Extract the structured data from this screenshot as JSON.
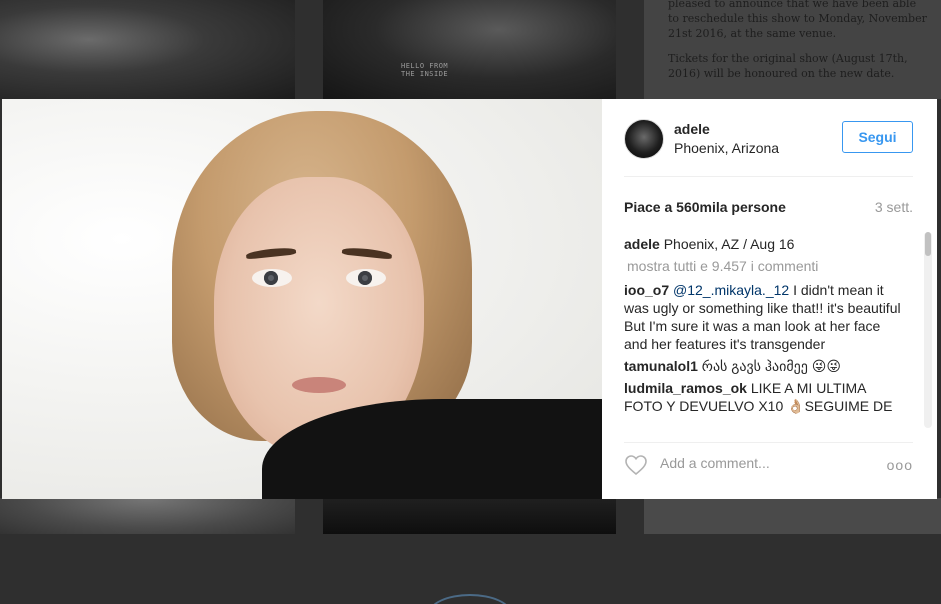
{
  "background": {
    "shirt_text": "HELLO FROM\nTHE INSIDE",
    "announcement_lines": [
      "pleased to announce that we have been able to reschedule this show to Monday, November 21st 2016, at the same venue.",
      "Tickets for the original show (August 17th, 2016) will be honoured on the new date."
    ]
  },
  "post": {
    "username": "adele",
    "location": "Phoenix, Arizona",
    "follow_label": "Segui",
    "likes": "Piace a 560mila persone",
    "time": "3 sett."
  },
  "caption": {
    "username": "adele",
    "text": "Phoenix, AZ / Aug 16"
  },
  "load_more": "mostra tutti e 9.457 i commenti",
  "comments": [
    {
      "user": "ioo_o7",
      "mention": "@12_.mikayla._12",
      "text": " I didn't mean it was ugly or something like that!! it's beautiful But I'm sure it was a man look at her face and her features it's transgender"
    },
    {
      "user": "tamunalol1",
      "mention": "",
      "text": " რას გავს ჰაიმეე 😜😜"
    },
    {
      "user": "ludmila_ramos_ok",
      "mention": "",
      "text": " LIKE A MI ULTIMA FOTO Y DEVUELVO X10 👌🏼SEGUIME DE"
    }
  ],
  "comment_box": {
    "placeholder": "Add a comment...",
    "more_label": "ooo"
  },
  "colors": {
    "accent": "#3897f0",
    "text": "#262626",
    "muted": "#999999",
    "mention": "#003569"
  },
  "icons": {
    "like": "heart-outline-icon",
    "more": "more-options-icon"
  }
}
